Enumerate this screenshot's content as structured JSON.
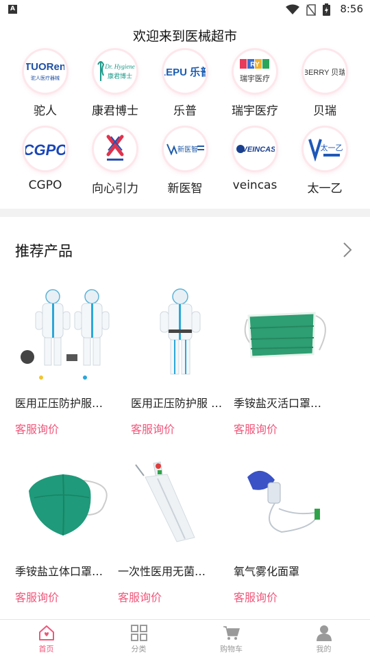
{
  "status_bar": {
    "time": "8:56",
    "app_indicator": "A",
    "icons": [
      "wifi-icon",
      "no-sim-icon",
      "battery-icon"
    ]
  },
  "header": {
    "title": "欢迎来到医械超市"
  },
  "brands": [
    {
      "name": "驼人",
      "logo_text": "TUORen",
      "logo_sub": "驼人医疗器械",
      "icon": "tuoren-logo"
    },
    {
      "name": "康君博士",
      "logo_text": "Dr. Hygiene",
      "logo_sub": "康君博士",
      "icon": "dr-hygiene-logo"
    },
    {
      "name": "乐普",
      "logo_text": "LEPU 乐普",
      "icon": "lepu-logo"
    },
    {
      "name": "瑞宇医疗",
      "logo_text": "RY",
      "logo_sub": "瑞宇医疗",
      "icon": "ruiyu-logo"
    },
    {
      "name": "贝瑞",
      "logo_text": "BERRY 贝瑞",
      "icon": "berry-logo"
    },
    {
      "name": "CGPO",
      "logo_text": "CGPO",
      "icon": "cgpo-logo"
    },
    {
      "name": "向心引力",
      "logo_text": "X",
      "icon": "xiangxin-logo"
    },
    {
      "name": "新医智",
      "logo_text": "新医智",
      "icon": "xinyizhi-logo"
    },
    {
      "name": "veincas",
      "logo_text": "VEINCAS",
      "icon": "veincas-logo"
    },
    {
      "name": "太一乙",
      "logo_text": "太一乙",
      "icon": "taiyiyi-logo"
    }
  ],
  "recommend": {
    "title": "推荐产品",
    "more_icon": "chevron-right-icon",
    "products": [
      {
        "name": "医用正压防护服…",
        "price": "客服询价",
        "image": "positive-pressure-suit-pair"
      },
      {
        "name": "医用正压防护服 …",
        "price": "客服询价",
        "image": "positive-pressure-suit-single"
      },
      {
        "name": "季铵盐灭活口罩…",
        "price": "客服询价",
        "image": "green-flat-mask"
      },
      {
        "name": "季铵盐立体口罩…",
        "price": "客服询价",
        "image": "green-3d-mask"
      },
      {
        "name": "一次性医用无菌…",
        "price": "客服询价",
        "image": "sterile-catheter"
      },
      {
        "name": "氧气雾化面罩",
        "price": "客服询价",
        "image": "oxygen-nebulizer-mask"
      }
    ]
  },
  "tabbar": {
    "tabs": [
      {
        "label": "首页",
        "icon": "home-icon",
        "active": true
      },
      {
        "label": "分类",
        "icon": "grid-icon",
        "active": false
      },
      {
        "label": "购物车",
        "icon": "cart-icon",
        "active": false
      },
      {
        "label": "我的",
        "icon": "user-icon",
        "active": false
      }
    ]
  },
  "colors": {
    "accent": "#f0567a",
    "inactive": "#9a9a9a",
    "divider": "#f2f2f2"
  }
}
